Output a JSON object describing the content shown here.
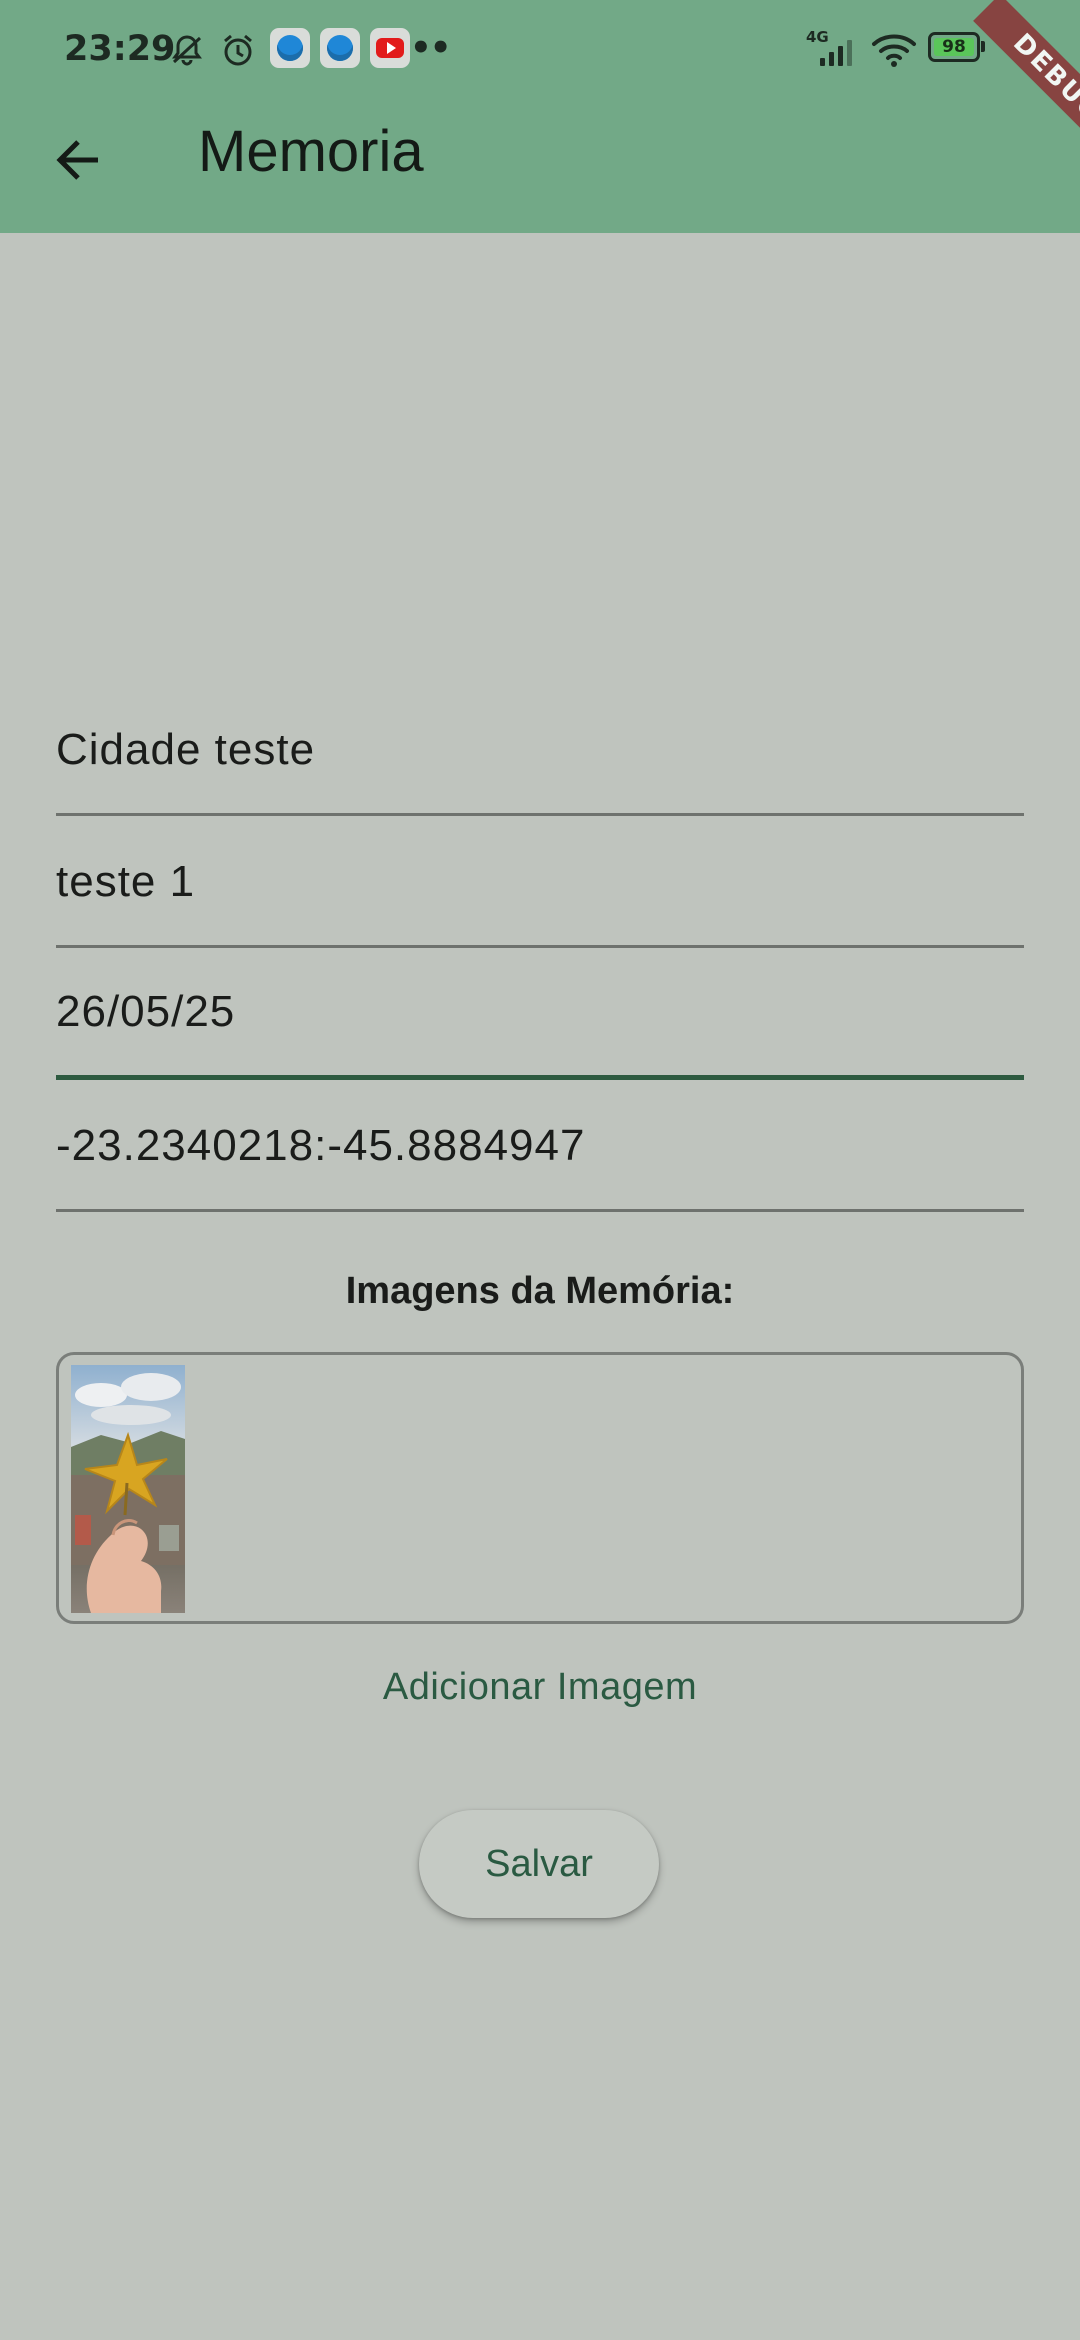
{
  "status_bar": {
    "time": "23:29",
    "network": "4G",
    "battery": "98",
    "more_indicator": "••",
    "icons": [
      "muted-bell-icon",
      "alarm-icon",
      "browser-app-icon",
      "browser-app-icon",
      "youtube-app-icon",
      "signal-icon",
      "wifi-icon",
      "battery-icon"
    ]
  },
  "debug_banner": "DEBUG",
  "colors": {
    "app_bar": "#72a987",
    "background": "#bfc4be",
    "accent": "#2a5a42"
  },
  "app_bar": {
    "title": "Memoria",
    "back_icon": "arrow-back-icon"
  },
  "form": {
    "fields": [
      {
        "value": "Cidade teste"
      },
      {
        "value": "teste 1"
      },
      {
        "value": "26/05/25"
      },
      {
        "value": "-23.2340218:-45.8884947"
      }
    ]
  },
  "images": {
    "title": "Imagens da Memória:",
    "items": [
      {
        "description": "photo-of-hand-holding-yellow-leaf"
      }
    ],
    "add_label": "Adicionar Imagem"
  },
  "actions": {
    "save_label": "Salvar"
  }
}
